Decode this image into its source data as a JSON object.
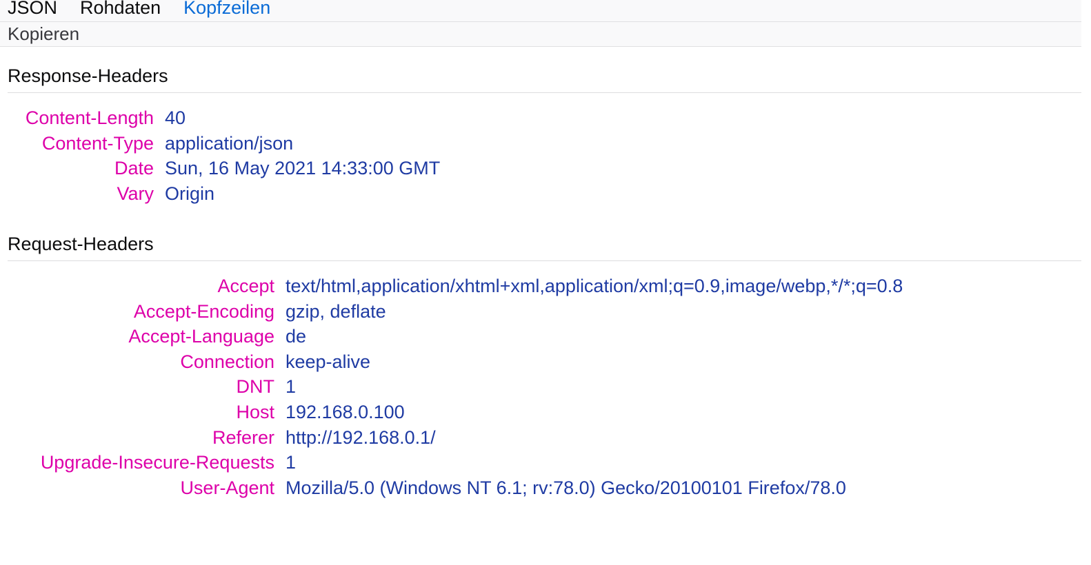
{
  "tabs": [
    {
      "label": "JSON",
      "active": false
    },
    {
      "label": "Rohdaten",
      "active": false
    },
    {
      "label": "Kopfzeilen",
      "active": true
    }
  ],
  "toolbar": {
    "copy_label": "Kopieren"
  },
  "response": {
    "title": "Response-Headers",
    "headers": [
      {
        "name": "Content-Length",
        "value": "40"
      },
      {
        "name": "Content-Type",
        "value": "application/json"
      },
      {
        "name": "Date",
        "value": "Sun, 16 May 2021 14:33:00 GMT"
      },
      {
        "name": "Vary",
        "value": "Origin"
      }
    ]
  },
  "request": {
    "title": "Request-Headers",
    "headers": [
      {
        "name": "Accept",
        "value": "text/html,application/xhtml+xml,application/xml;q=0.9,image/webp,*/*;q=0.8"
      },
      {
        "name": "Accept-Encoding",
        "value": "gzip, deflate"
      },
      {
        "name": "Accept-Language",
        "value": "de"
      },
      {
        "name": "Connection",
        "value": "keep-alive"
      },
      {
        "name": "DNT",
        "value": "1"
      },
      {
        "name": "Host",
        "value": "192.168.0.100"
      },
      {
        "name": "Referer",
        "value": "http://192.168.0.1/"
      },
      {
        "name": "Upgrade-Insecure-Requests",
        "value": "1"
      },
      {
        "name": "User-Agent",
        "value": "Mozilla/5.0 (Windows NT 6.1; rv:78.0) Gecko/20100101 Firefox/78.0"
      }
    ]
  },
  "colors": {
    "header_name": "#dd00a9",
    "header_value": "#1f3ba3",
    "active_tab": "#0a6bd6"
  }
}
